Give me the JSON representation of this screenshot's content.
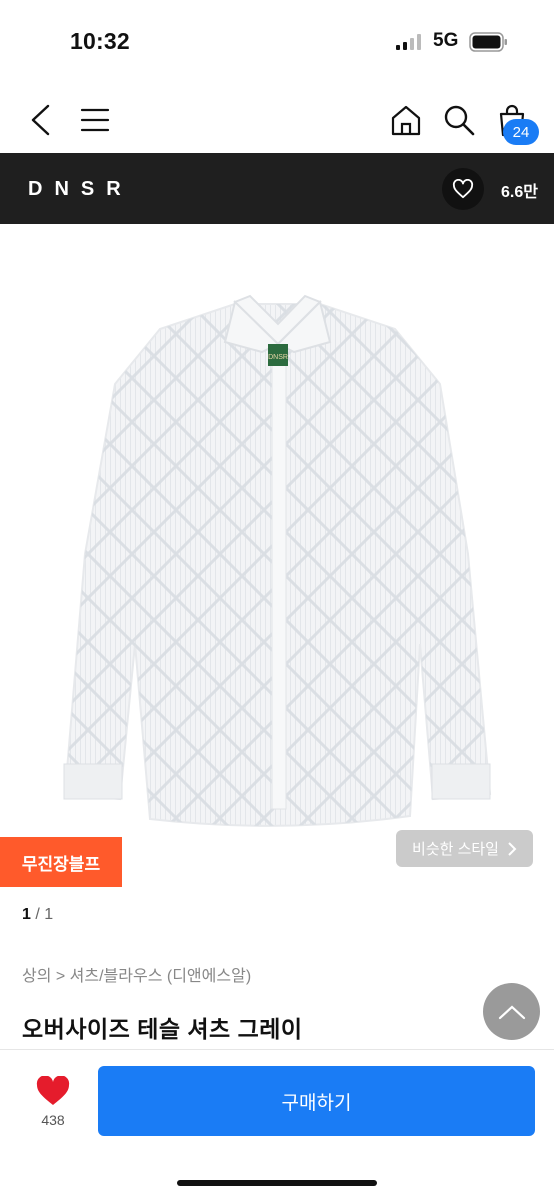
{
  "status_bar": {
    "time": "10:32",
    "network": "5G",
    "icons": [
      "signal-icon",
      "battery-icon"
    ]
  },
  "nav": {
    "icons": [
      "back-icon",
      "menu-icon",
      "home-icon",
      "search-icon",
      "cart-icon"
    ],
    "cart_count": "24"
  },
  "brand": {
    "name": "DNSR",
    "likes": "6.6만",
    "like_icon": "heart-outline-icon"
  },
  "product": {
    "image_label": "DNSR",
    "promo_badge": "무진장블프",
    "similar_style": "비슷한 스타일",
    "pager_current": "1",
    "pager_sep": " / ",
    "pager_total": "1",
    "breadcrumb": "상의 > 셔츠/블라우스 (디앤에스알)",
    "title": "오버사이즈 테슬 셔츠 그레이"
  },
  "bottom_bar": {
    "wish_count": "438",
    "buy_label": "구매하기",
    "wish_icon": "heart-filled-icon"
  },
  "colors": {
    "accent": "#1a7cf5",
    "promo": "#ff5a2b",
    "brand_bar": "#1f1f1f",
    "wish_heart": "#e51c2c"
  }
}
